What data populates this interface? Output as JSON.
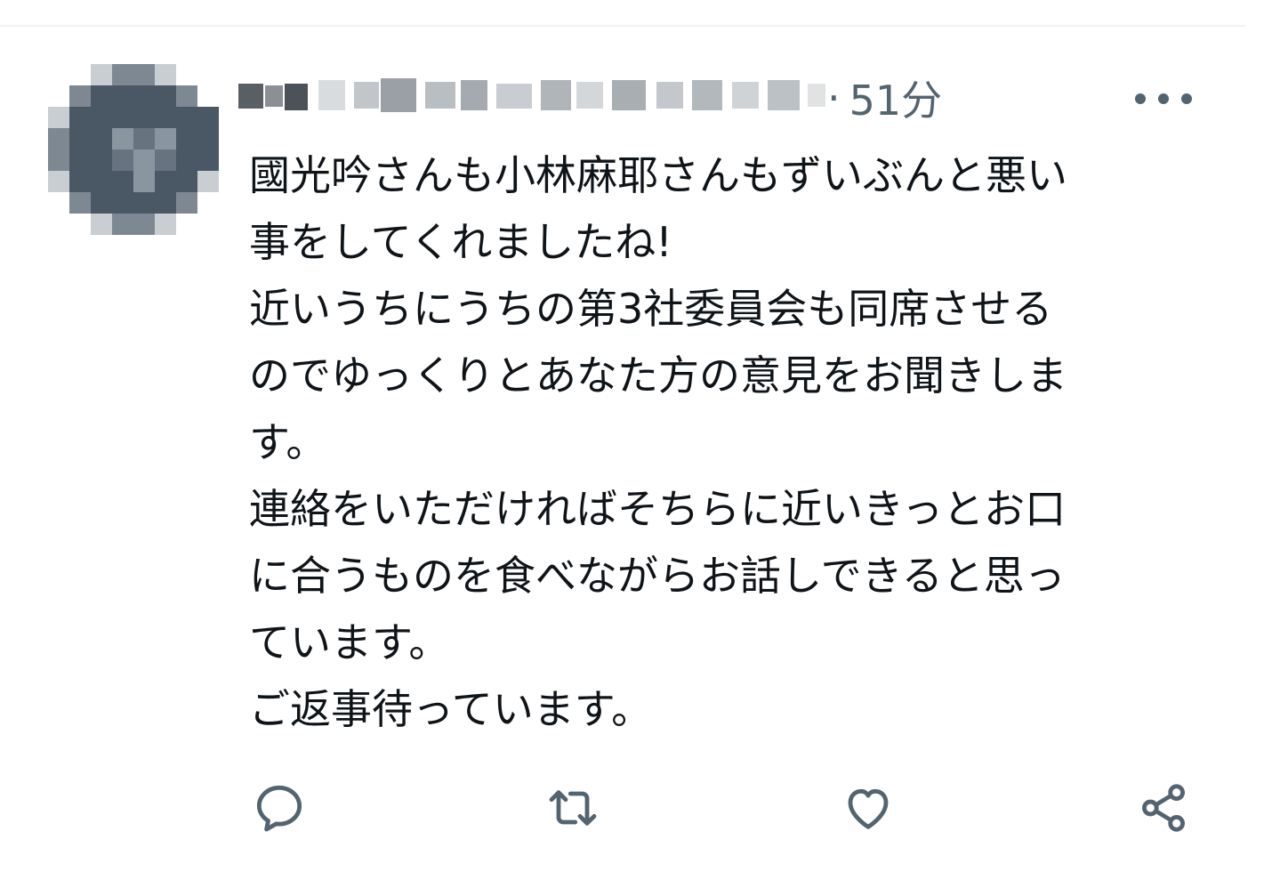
{
  "post": {
    "handle_redacted": true,
    "separator": "·",
    "time": "51分",
    "more_label": "…",
    "lines": [
      "國光吟さんも小林麻耶さんもずいぶんと悪い",
      "事をしてくれましたね!",
      "近いうちにうちの第3社委員会も同席させる",
      "のでゆっくりとあなた方の意見をお聞きしま",
      "す。",
      "連絡をいただければそちらに近いきっとお口",
      "に合うものを食べながらお話しできると思っ",
      "ています。",
      "ご返事待っています。"
    ]
  },
  "actions": {
    "reply_icon": "reply-icon",
    "repost_icon": "repost-icon",
    "like_icon": "heart-icon",
    "share_icon": "share-icon"
  },
  "colors": {
    "text": "#0f1419",
    "secondary": "#536471",
    "border": "#eff3f4",
    "avatar": "#4a5866"
  }
}
